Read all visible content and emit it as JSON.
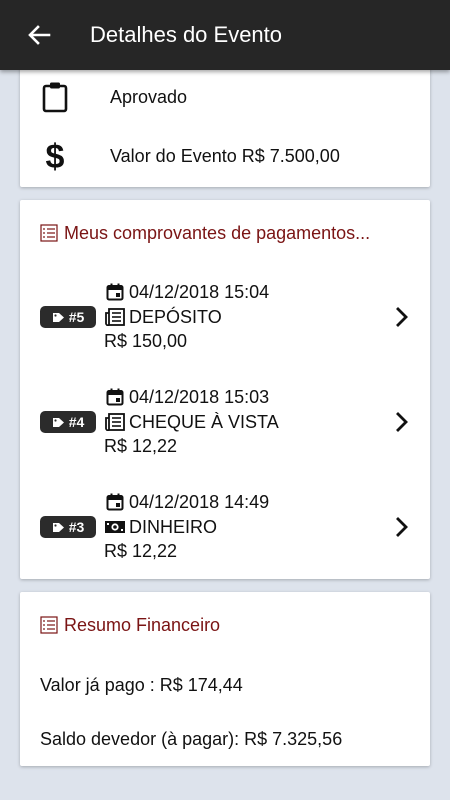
{
  "header": {
    "title": "Detalhes do Evento",
    "back_icon": "arrow-back-icon"
  },
  "event": {
    "status": "Aprovado",
    "value_label": "Valor do Evento R$ 7.500,00"
  },
  "payments_section": {
    "title": "Meus comprovantes de pagamentos...",
    "items": [
      {
        "badge": "#5",
        "datetime": "04/12/2018 15:04",
        "type": "DEPÓSITO",
        "type_icon": "receipt-icon",
        "amount": "R$ 150,00"
      },
      {
        "badge": "#4",
        "datetime": "04/12/2018 15:03",
        "type": "CHEQUE À VISTA",
        "type_icon": "receipt-icon",
        "amount": "R$ 12,22"
      },
      {
        "badge": "#3",
        "datetime": "04/12/2018 14:49",
        "type": "DINHEIRO",
        "type_icon": "cash-icon",
        "amount": "R$ 12,22"
      }
    ]
  },
  "summary": {
    "title": "Resumo Financeiro",
    "paid": "Valor já pago : R$ 174,44",
    "balance": "Saldo devedor (à pagar): R$ 7.325,56"
  },
  "colors": {
    "appbar": "#262626",
    "accent_title": "#7a1414",
    "background": "#dde3ec",
    "badge": "#2b2b2b"
  }
}
